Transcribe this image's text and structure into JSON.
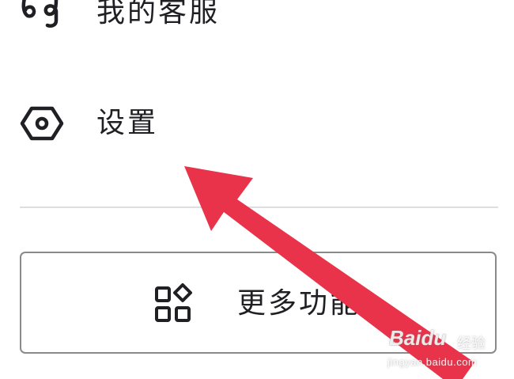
{
  "menu": {
    "items": [
      {
        "label": "我的客服",
        "icon": "customer-service-icon"
      },
      {
        "label": "设置",
        "icon": "settings-hexagon-icon"
      }
    ]
  },
  "more_button": {
    "label": "更多功能",
    "icon": "apps-grid-icon"
  },
  "annotation": {
    "type": "arrow",
    "color": "#e8334a"
  },
  "watermark": {
    "brand": "Baidu",
    "sub": "经验",
    "url": "jingyan.baidu.com"
  },
  "colors": {
    "text": "#1f1f24",
    "divider": "#dedede",
    "button_border": "#8a8a8a",
    "arrow": "#e8334a"
  }
}
